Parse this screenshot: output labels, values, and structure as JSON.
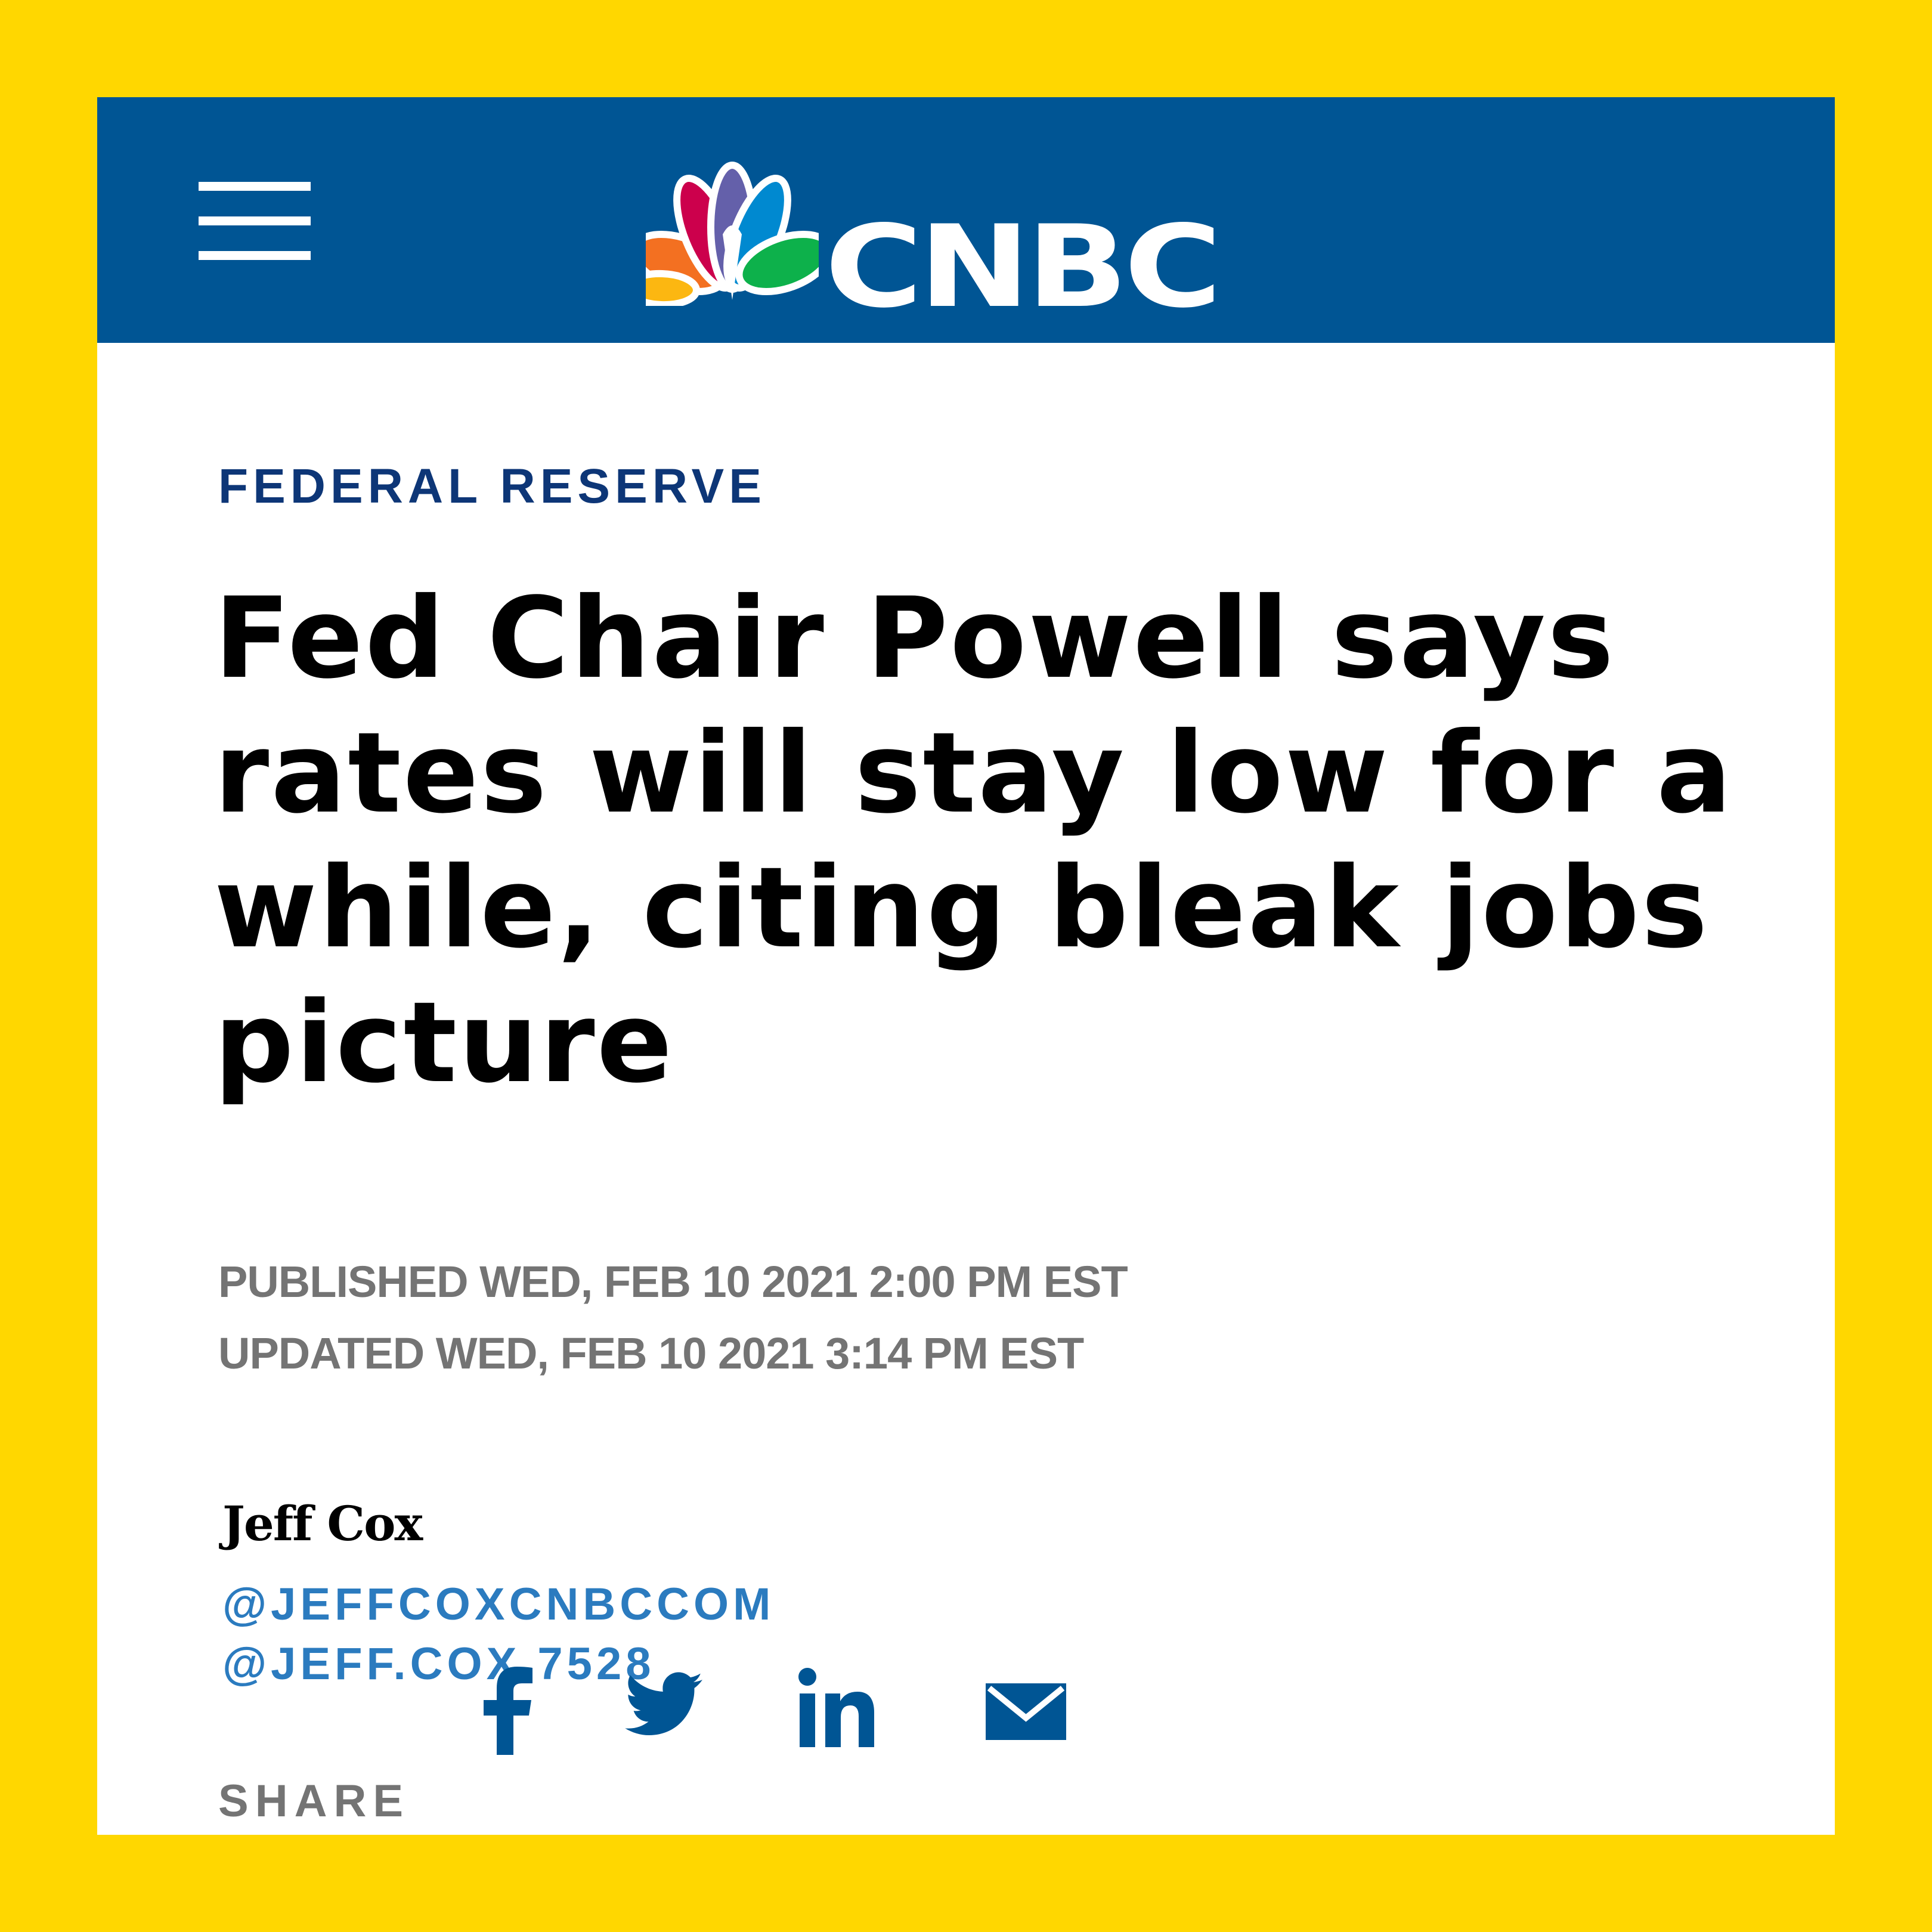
{
  "header": {
    "logo_text": "CNBC",
    "menu_icon": "hamburger-menu-icon",
    "background": "#005594",
    "peacock_colors": [
      "#F37021",
      "#CC004C",
      "#6460AA",
      "#0089D0",
      "#0DB14B",
      "#FCB711"
    ]
  },
  "article": {
    "section": "FEDERAL RESERVE",
    "headline": "Fed Chair Powell says rates will stay low for a while, citing bleak jobs picture",
    "published": "PUBLISHED WED, FEB 10 2021 2:00 PM EST",
    "updated": "UPDATED WED, FEB 10 2021 3:14 PM EST"
  },
  "byline": {
    "author": "Jeff Cox",
    "handles": [
      "@JEFFCOXCNBCCOM",
      "@JEFF.COX.7528"
    ]
  },
  "share": {
    "label": "SHARE",
    "icons": [
      "facebook-icon",
      "twitter-icon",
      "linkedin-icon",
      "email-icon"
    ],
    "icon_color": "#005594"
  },
  "colors": {
    "frame": "#FFD700",
    "section": "#0D3677",
    "meta": "#747474",
    "link": "#2B7BBF"
  }
}
